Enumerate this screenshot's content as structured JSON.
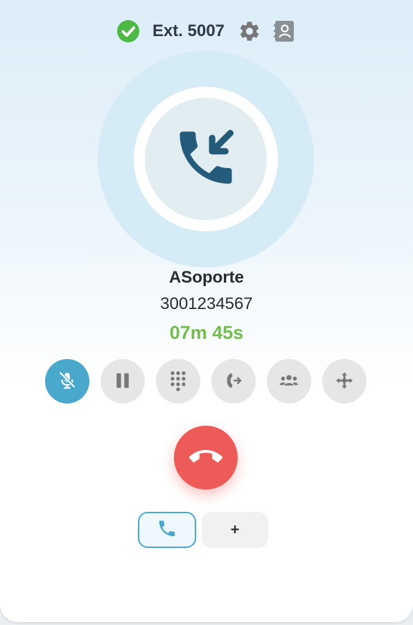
{
  "header": {
    "extension_label": "Ext. 5007",
    "status_color": "#4cb944",
    "status_icon": "check-circle-icon",
    "settings_icon": "gear-icon",
    "contacts_icon": "contacts-book-icon"
  },
  "call": {
    "direction_icon": "incoming-call-icon",
    "caller_name": "ASoporte",
    "caller_number": "3001234567",
    "duration": "07m 45s",
    "duration_color": "#71be4b"
  },
  "controls": [
    {
      "name": "mute",
      "icon": "microphone-muted-icon",
      "active": true
    },
    {
      "name": "hold",
      "icon": "pause-icon",
      "active": false
    },
    {
      "name": "keypad",
      "icon": "dialpad-icon",
      "active": false
    },
    {
      "name": "transfer",
      "icon": "call-transfer-icon",
      "active": false
    },
    {
      "name": "conference",
      "icon": "group-icon",
      "active": false
    },
    {
      "name": "move",
      "icon": "move-arrows-icon",
      "active": false
    }
  ],
  "hangup": {
    "icon": "hang-up-icon",
    "color": "#ee5a57"
  },
  "lines": {
    "active_line_icon": "phone-icon",
    "add_label": "+"
  },
  "colors": {
    "accent": "#4aa8cc",
    "icon_dark": "#245b7a",
    "control_bg": "#e6e6e6",
    "control_icon": "#777777"
  }
}
